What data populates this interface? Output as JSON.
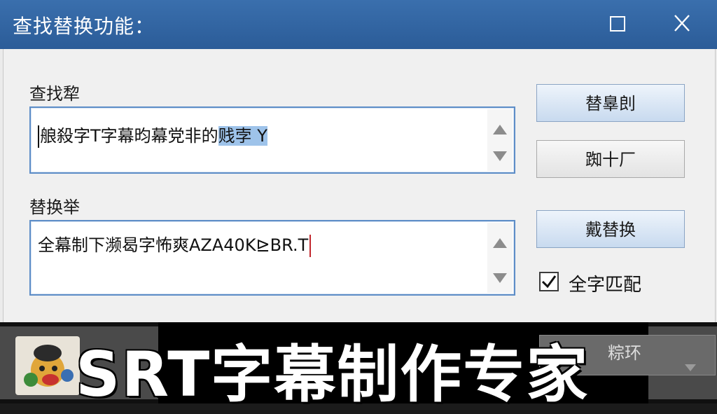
{
  "window": {
    "title": "查找替换功能："
  },
  "find": {
    "label": "查找犂",
    "value_plain": "艆殺字T字幕昀幕党非的",
    "value_selected": "贱孛 Y"
  },
  "replace": {
    "label": "替换举",
    "value": "全幕制下濒曷字怖爽AZA40K⊵BR.T"
  },
  "buttons": {
    "replace_label": "替辠剆",
    "second_label": "踟十厂",
    "replace_all_label": "戴替换"
  },
  "options": {
    "match_whole_word_label": "全字匹配",
    "match_whole_word_checked": true
  },
  "footer": {
    "banner_text": "SRT字幕制作专家",
    "partial_button_text": "粽环"
  },
  "colors": {
    "titlebar": "#2e63a0",
    "selection": "#9ec3ea",
    "input_border": "#5d8dc7"
  }
}
